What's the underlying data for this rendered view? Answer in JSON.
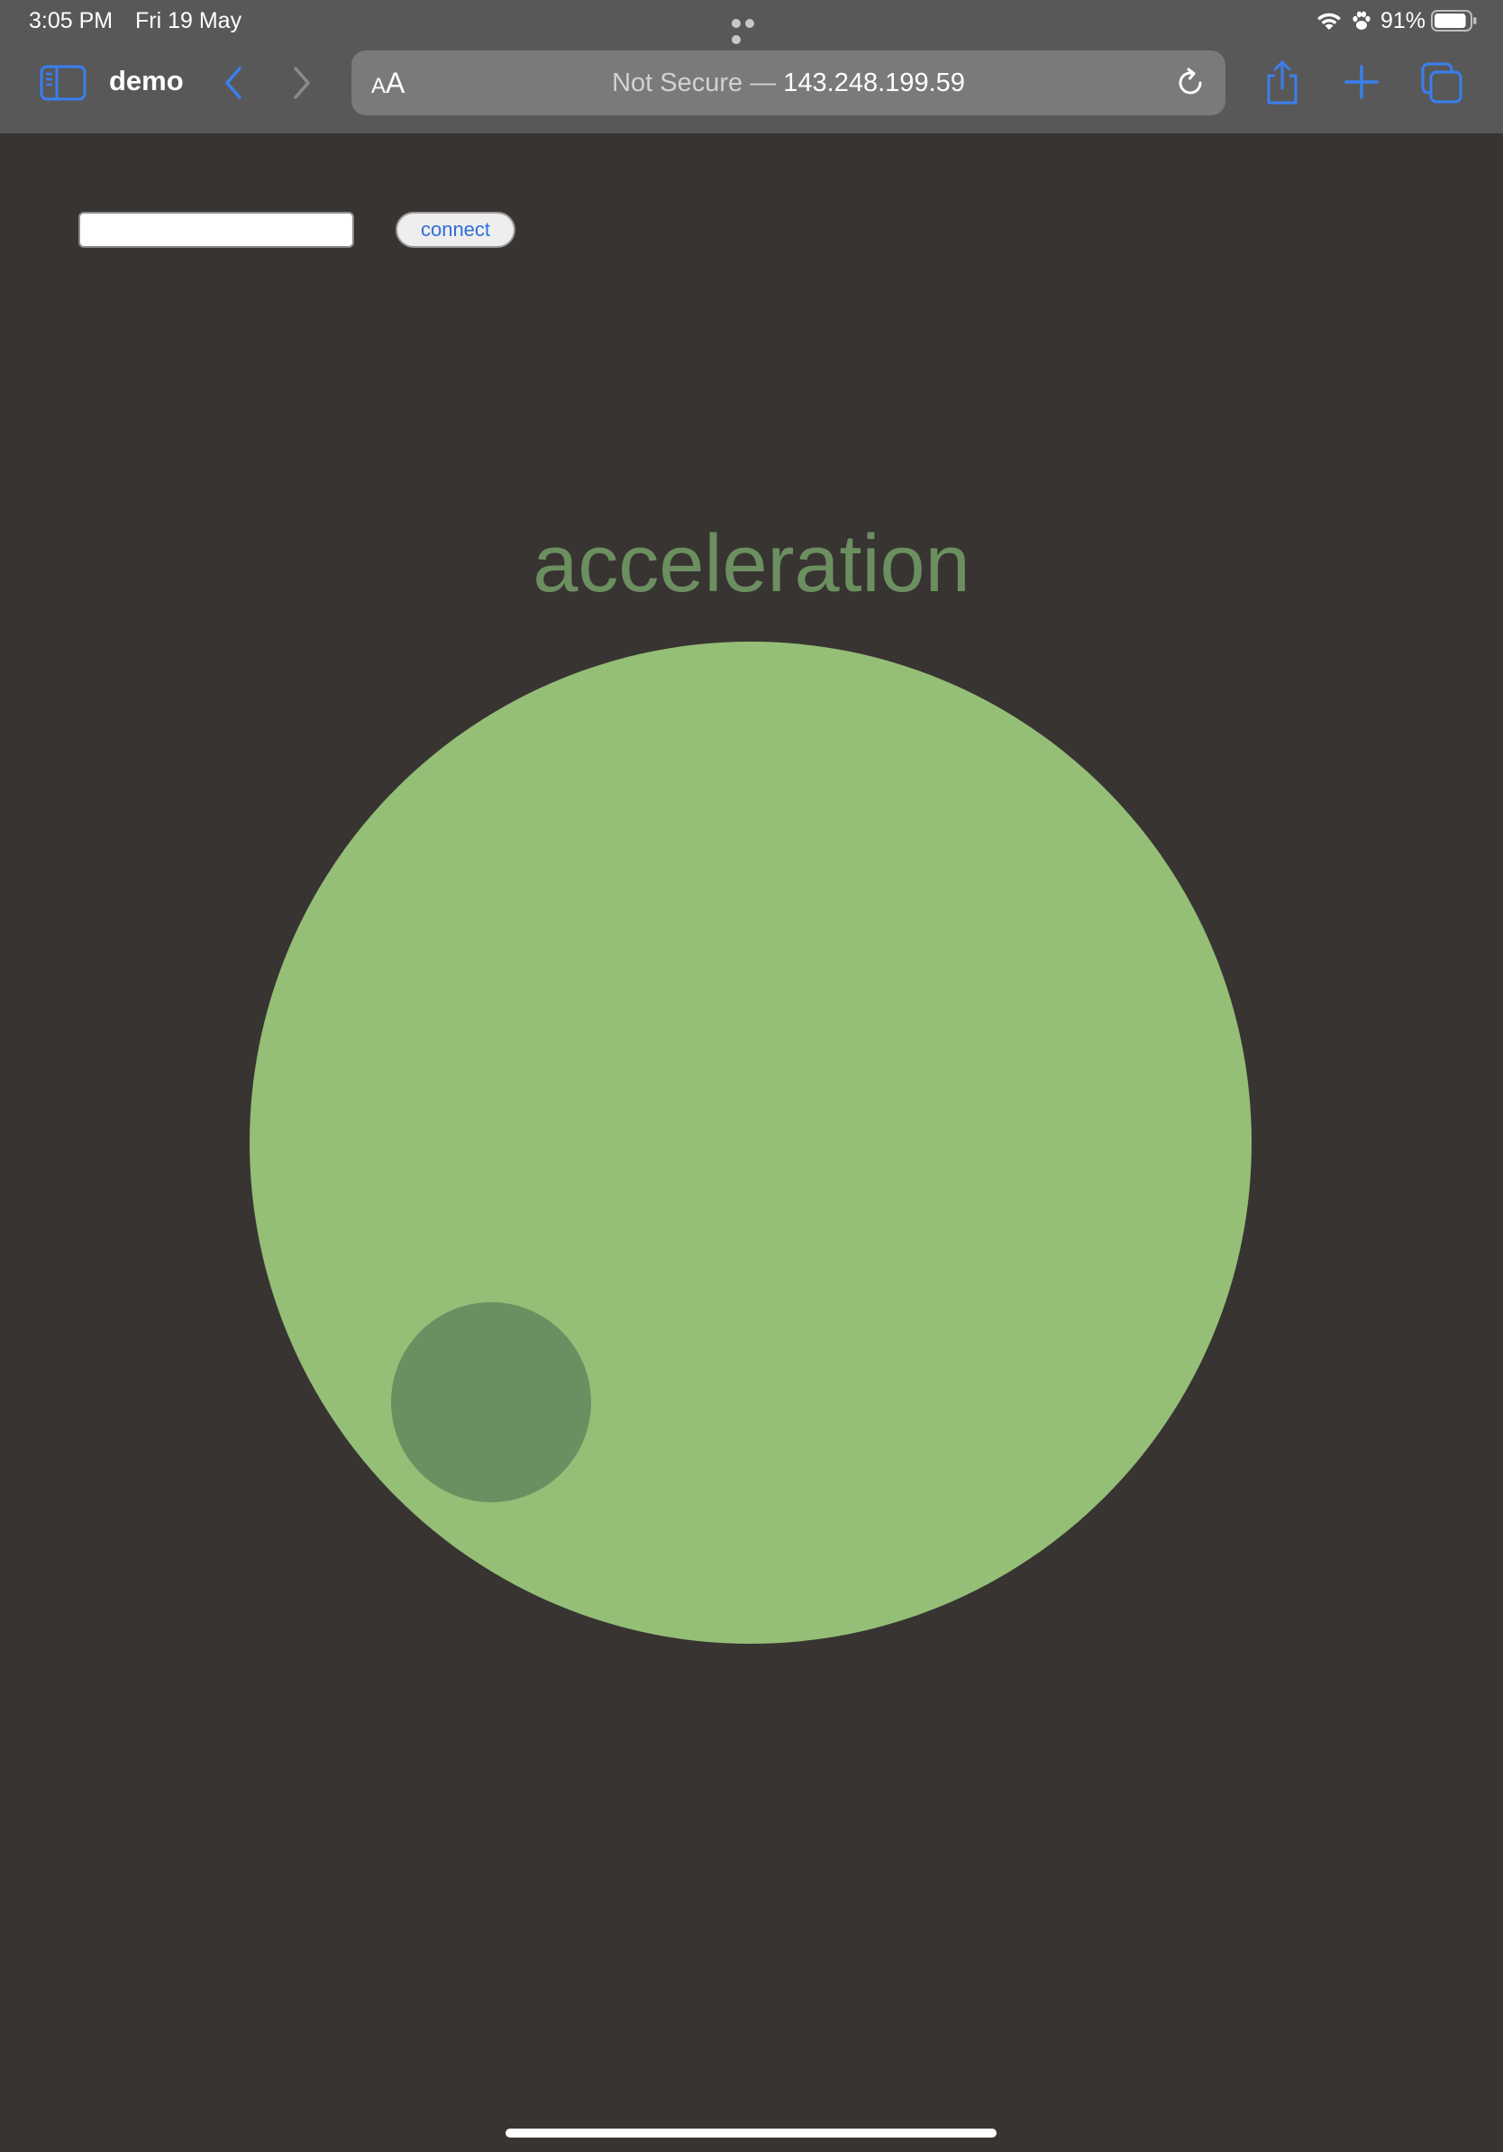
{
  "status_bar": {
    "time": "3:05 PM",
    "date": "Fri 19 May",
    "battery_percent": "91%",
    "battery_level": 0.91
  },
  "browser": {
    "tab_title": "demo",
    "reader_label_small": "A",
    "reader_label_large": "A",
    "url_prefix": "Not Secure —",
    "url_host": "143.248.199.59",
    "accent_color": "#3a7ff0"
  },
  "page": {
    "connect_label": "connect",
    "server_input_value": "",
    "heading": "acceleration",
    "colors": {
      "background": "#383432",
      "outer_circle": "#95be77",
      "indicator_dot": "#6c8f61",
      "heading": "#6c8f60"
    }
  }
}
